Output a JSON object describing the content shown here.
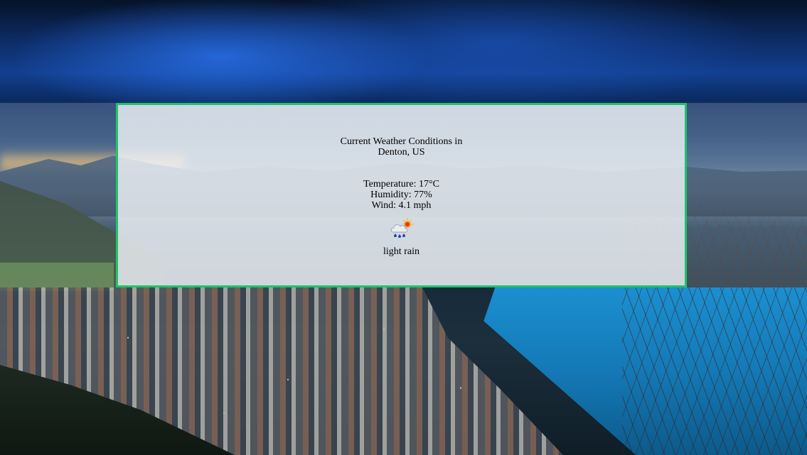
{
  "panel": {
    "heading_line1": "Current Weather Conditions in",
    "heading_line2": "Denton, US",
    "temperature": "Temperature: 17°C",
    "humidity": "Humidity: 77%",
    "wind": "Wind: 4.1 mph",
    "icon": "light-rain-icon",
    "description": "light rain"
  },
  "colors": {
    "panel_border": "#1fc36a",
    "panel_background": "#f0f4f8"
  }
}
